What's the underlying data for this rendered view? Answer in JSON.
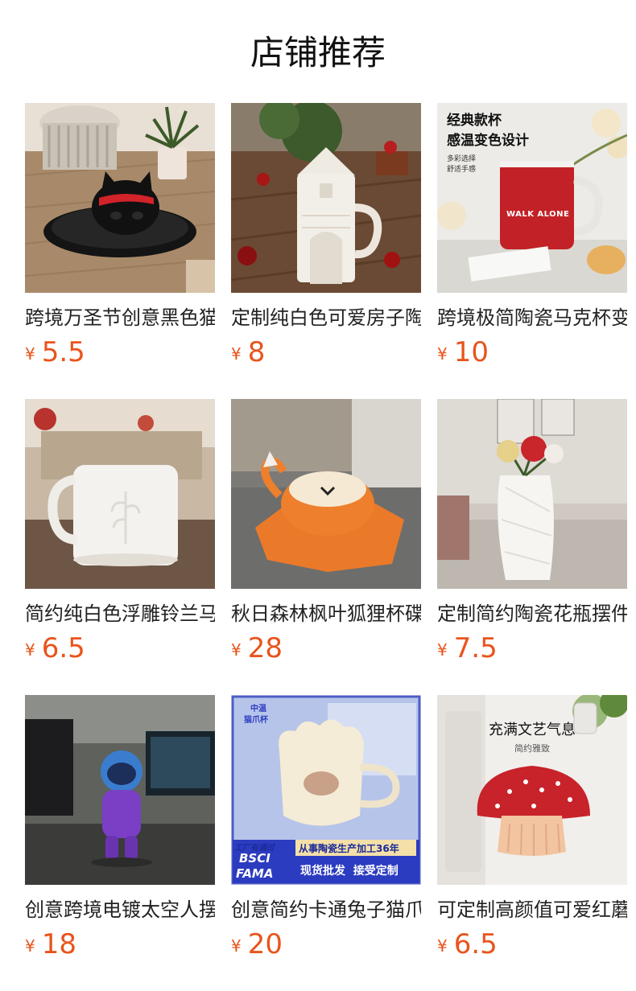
{
  "page": {
    "title": "店铺推荐"
  },
  "currency_symbol": "¥",
  "products": [
    {
      "name": "跨境万圣节创意黑色猫咪陶瓷烟灰缸",
      "price": "5.5"
    },
    {
      "name": "定制纯白色可爱房子陶瓷马克杯",
      "price": "8"
    },
    {
      "name": "跨境极简陶瓷马克杯变色杯",
      "price": "10",
      "overlay": {
        "line1": "经典款杯",
        "line2": "感温变色设计",
        "line3": "多彩选择",
        "line4": "舒适手感",
        "mug_text": "WALK ALONE"
      }
    },
    {
      "name": "简约纯白色浮雕铃兰马克杯",
      "price": "6.5"
    },
    {
      "name": "秋日森林枫叶狐狸杯碟套装",
      "price": "28"
    },
    {
      "name": "定制简约陶瓷花瓶摆件",
      "price": "7.5"
    },
    {
      "name": "创意跨境电镀太空人摆件",
      "price": "18"
    },
    {
      "name": "创意简约卡通兔子猫爪杯",
      "price": "20",
      "overlay": {
        "tag1": "中温",
        "tag2": "猫爪杯",
        "factory": "工厂有通过",
        "bsci": "BSCI",
        "fama": "FAMA",
        "banner": "从事陶瓷生产加工36年",
        "cta": "现货批发  接受定制"
      }
    },
    {
      "name": "可定制高颜值可爱红蘑菇陶瓷盘",
      "price": "6.5",
      "overlay": {
        "line1": "充满文艺气息",
        "line2": "简约雅致"
      }
    }
  ],
  "colors": {
    "price": "#e8541c",
    "title": "#111111"
  }
}
